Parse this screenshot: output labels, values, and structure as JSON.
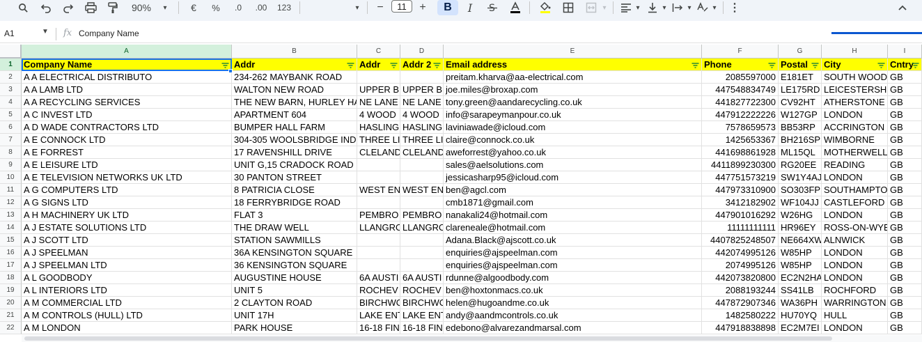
{
  "toolbar": {
    "zoom": "90%",
    "currency": "€",
    "percent": "%",
    "decrease_decimal": ".0",
    "increase_decimal": ".00",
    "number_format": "123",
    "font_size": "11",
    "minus": "−",
    "plus": "+",
    "bold": "B",
    "italic": "I"
  },
  "formula_bar": {
    "cell_ref": "A1",
    "fx": "fx",
    "content": "Company Name"
  },
  "columns": [
    "A",
    "B",
    "C",
    "D",
    "E",
    "F",
    "G",
    "H",
    "I"
  ],
  "header": [
    "Company Name",
    "Addr",
    "Addr",
    "Addr 2",
    "Email address",
    "Phone",
    "Postal",
    "City",
    "Cntry"
  ],
  "rows": [
    [
      "1",
      ""
    ],
    [
      "2",
      "A  A ELECTRICAL DISTRIBUTO",
      "234-262 MAYBANK ROAD",
      "",
      "",
      "preitam.kharva@aa-electrical.com",
      "2085597000",
      "E181ET",
      "SOUTH WOOD",
      "GB"
    ],
    [
      "3",
      "A  A LAMB LTD",
      "WALTON NEW ROAD",
      "UPPER B",
      "UPPER B",
      "joe.miles@broxap.com",
      "447548834749",
      "LE175RD",
      "LEICESTERSH",
      "GB"
    ],
    [
      "4",
      "A  A RECYCLING SERVICES",
      "THE NEW BARN, HURLEY HA",
      "NE LANE",
      "NE LANE",
      "tony.green@aandarecycling.co.uk",
      "441827722300",
      "CV92HT",
      "ATHERSTONE",
      "GB"
    ],
    [
      "5",
      "A  C INVEST LTD",
      "APARTMENT 604",
      "4 WOOD",
      "4 WOOD",
      "info@sarapeymanpour.co.uk",
      "447912222226",
      "W127GP",
      "LONDON",
      "GB"
    ],
    [
      "6",
      "A  D WADE CONTRACTORS LTD",
      "BUMPER HALL FARM",
      "HASLING",
      "HASLING",
      "laviniawade@icloud.com",
      "7578659573",
      "BB53RP",
      "ACCRINGTON",
      "GB"
    ],
    [
      "7",
      "A  E CONNOCK LTD",
      "304-305 WOOLSBRIDGE IND",
      "THREE LI",
      "THREE LI",
      "claire@connock.co.uk",
      "1425653367",
      "BH216SP",
      "WIMBORNE",
      "GB"
    ],
    [
      "8",
      "A  E FORREST",
      "17 RAVENSHILL DRIVE",
      "CLELAND",
      "CLELAND",
      "aweforrest@yahoo.co.uk",
      "441698861928",
      "ML15QL",
      "MOTHERWELL",
      "GB"
    ],
    [
      "9",
      "A  E LEISURE LTD",
      "UNIT G,15 CRADOCK ROAD",
      "",
      "",
      "sales@aelsolutions.com",
      "4411899230300",
      "RG20EE",
      "READING",
      "GB"
    ],
    [
      "10",
      "A  E TELEVISION NETWORKS UK LTD",
      "30 PANTON STREET",
      "",
      "",
      "jessicasharp95@icloud.com",
      "447751573219",
      "SW1Y4AJ",
      "LONDON",
      "GB"
    ],
    [
      "11",
      "A  G COMPUTERS LTD",
      "8 PATRICIA CLOSE",
      "WEST EN",
      "WEST EN",
      "ben@agcl.com",
      "447973310900",
      "SO303FP",
      "SOUTHAMPTO",
      "GB"
    ],
    [
      "12",
      "A  G SIGNS LTD",
      "18 FERRYBRIDGE ROAD",
      "",
      "",
      "cmb1871@gmail.com",
      "3412182902",
      "WF104JJ",
      "CASTLEFORD",
      "GB"
    ],
    [
      "13",
      "A  H MACHINERY UK LTD",
      "FLAT 3",
      "PEMBRO",
      "PEMBRO",
      "nanakali24@hotmail.com",
      "447901016292",
      "W26HG",
      "LONDON",
      "GB"
    ],
    [
      "14",
      "A  J ESTATE SOLUTIONS LTD",
      "THE DRAW WELL",
      "LLANGRO",
      "LLANGRO",
      "clareneale@hotmail.com",
      "11111111111",
      "HR96EY",
      "ROSS-ON-WYE",
      "GB"
    ],
    [
      "15",
      "A  J SCOTT LTD",
      "STATION SAWMILLS",
      "",
      "",
      "Adana.Black@ajscott.co.uk",
      "4407825248507",
      "NE664XW",
      "ALNWICK",
      "GB"
    ],
    [
      "16",
      "A  J SPEELMAN",
      "36A KENSINGTON SQUARE",
      "",
      "",
      "enquiries@ajspeelman.com",
      "442074995126",
      "W85HP",
      "LONDON",
      "GB"
    ],
    [
      "17",
      "A  J SPEELMAN LTD",
      "36 KENSINGTON SQUARE",
      "",
      "",
      "enquiries@ajspeelman.com",
      "2074995126",
      "W85HP",
      "LONDON",
      "GB"
    ],
    [
      "18",
      "A  L GOODBODY",
      "AUGUSTINE HOUSE",
      "6A AUSTI",
      "6A AUSTI",
      "rdunne@algoodbody.com",
      "442073820800",
      "EC2N2HA",
      "LONDON",
      "GB"
    ],
    [
      "19",
      "A  L INTERIORS LTD",
      "UNIT 5",
      "ROCHEV",
      "ROCHEV",
      "ben@hoxtonmacs.co.uk",
      "2088193244",
      "SS41LB",
      "ROCHFORD",
      "GB"
    ],
    [
      "20",
      "A  M COMMERCIAL LTD",
      "2 CLAYTON ROAD",
      "BIRCHWO",
      "BIRCHWO",
      "helen@hugoandme.co.uk",
      "447872907346",
      "WA36PH",
      "WARRINGTON",
      "GB"
    ],
    [
      "21",
      "A  M CONTROLS (HULL) LTD",
      "UNIT 17H",
      "LAKE ENT",
      "LAKE ENT",
      "andy@aandmcontrols.co.uk",
      "1482580222",
      "HU70YQ",
      "HULL",
      "GB"
    ],
    [
      "22",
      "A  M LONDON",
      "PARK HOUSE",
      "16-18 FIN",
      "16-18 FIN",
      "edebono@alvarezandmarsal.com",
      "447918838898",
      "EC2M7EI",
      "LONDON",
      "GB"
    ]
  ]
}
